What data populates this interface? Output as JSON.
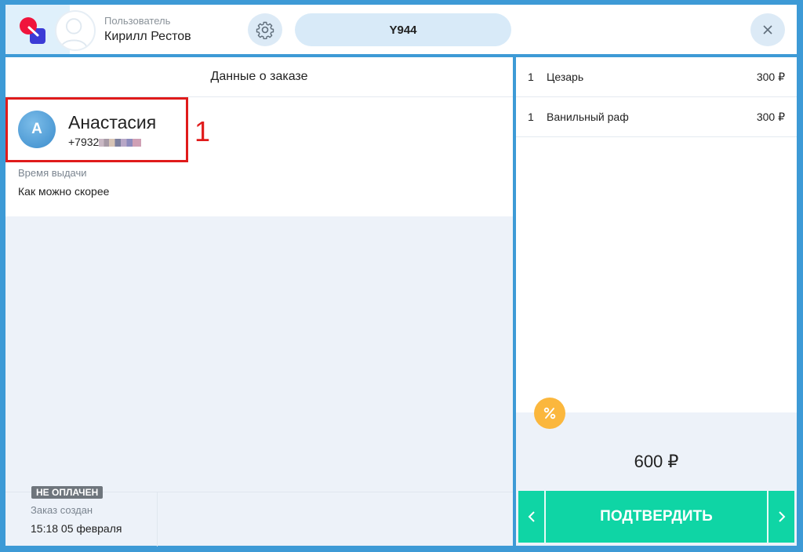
{
  "header": {
    "user_label": "Пользователь",
    "user_name": "Кирилл Рестов",
    "order_number": "Y944"
  },
  "order": {
    "title": "Данные о заказе",
    "customer": {
      "initial": "A",
      "name": "Анастасия",
      "phone": "+7932"
    },
    "annotation_number": "1",
    "pickup_time_label": "Время выдачи",
    "pickup_time_value": "Как можно скорее",
    "status_badge": "НЕ ОПЛАЧЕН",
    "created_label": "Заказ создан",
    "created_value": "15:18 05 февраля"
  },
  "cart": {
    "items": [
      {
        "qty": "1",
        "name": "Цезарь",
        "price": "300 ₽"
      },
      {
        "qty": "1",
        "name": "Ванильный раф",
        "price": "300 ₽"
      }
    ],
    "total": "600 ₽",
    "confirm_label": "ПОДТВЕРДИТЬ"
  },
  "colors": {
    "accent": "#0fd5a5",
    "frame": "#3d9ad6",
    "highlight": "#e01b1b",
    "discount": "#fbb73d",
    "badge": "#6e757c"
  },
  "icons": {
    "logo": "app-logo",
    "user": "user-silhouette-icon",
    "settings": "gear-icon",
    "close": "close-icon",
    "discount": "percent-icon",
    "prev": "chevron-left-icon",
    "next": "chevron-right-icon"
  }
}
